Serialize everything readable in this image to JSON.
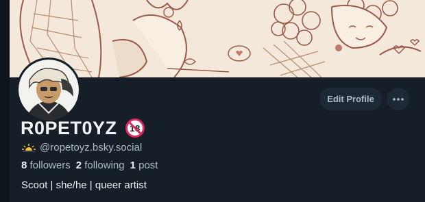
{
  "profile": {
    "display_name": "R0PET0YZ",
    "handle": "@ropetoyz.bsky.social",
    "bio": "Scoot | she/he | queer artist",
    "badge": "18",
    "stats": {
      "followers_count": "8",
      "followers_label": "followers",
      "following_count": "2",
      "following_label": "following",
      "posts_count": "1",
      "posts_label": "post"
    }
  },
  "actions": {
    "edit_profile_label": "Edit Profile",
    "more_icon": "ellipsis-icon"
  },
  "icons": {
    "handle_prefix": "sunrise-icon",
    "badge": "no-under-18-icon"
  },
  "colors": {
    "background": "#161e27",
    "button_bg": "#1e2936",
    "muted_text": "#aebbc9",
    "badge_red": "#e0245e",
    "banner_bg": "#f3e8d9",
    "banner_line": "#9a5a4a"
  }
}
